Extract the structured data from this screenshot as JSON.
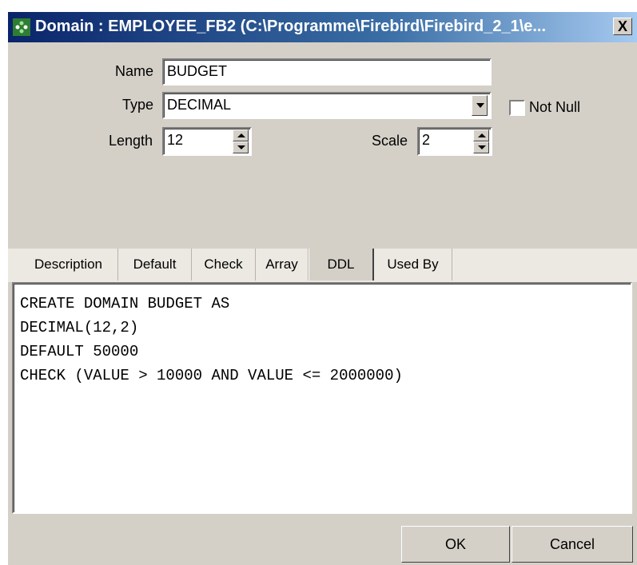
{
  "window": {
    "title": "Domain : EMPLOYEE_FB2 (C:\\Programme\\Firebird\\Firebird_2_1\\e...",
    "close_label": "X"
  },
  "form": {
    "name_label": "Name",
    "name_value": "BUDGET",
    "type_label": "Type",
    "type_value": "DECIMAL",
    "not_null_label": "Not Null",
    "length_label": "Length",
    "length_value": "12",
    "scale_label": "Scale",
    "scale_value": "2"
  },
  "tabs": [
    {
      "label": "Description"
    },
    {
      "label": "Default"
    },
    {
      "label": "Check"
    },
    {
      "label": "Array"
    },
    {
      "label": "DDL"
    },
    {
      "label": "Used By"
    }
  ],
  "active_tab": "DDL",
  "ddl": {
    "lines": [
      "CREATE DOMAIN BUDGET AS",
      "DECIMAL(12,2)",
      "DEFAULT 50000",
      "CHECK (VALUE > 10000 AND VALUE <= 2000000)"
    ]
  },
  "buttons": {
    "ok_label": "OK",
    "cancel_label": "Cancel"
  }
}
